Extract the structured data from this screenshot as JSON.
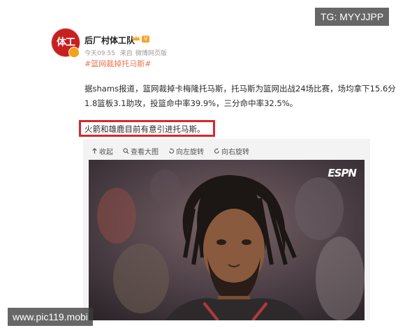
{
  "post": {
    "user_name": "后厂村体工队",
    "level_badge": "V",
    "time": "今天09:55",
    "source_prefix": "来自",
    "source": "微博网页版",
    "topic": "#篮网裁掉托马斯#",
    "body_lines": [
      "据shams报道，篮网裁掉卡梅隆托马斯，托马斯为篮网出战24场比赛，场均拿下15.6分",
      "1.8篮板3.1助攻，投篮命中率39.9%，三分命中率32.5%。"
    ],
    "highlight_text": "火箭和雄鹿目前有意引进托马斯。"
  },
  "media_toolbar": {
    "collapse": "收起",
    "view_large": "查看大图",
    "rotate_left": "向左旋转",
    "rotate_right": "向右旋转"
  },
  "photo": {
    "logo": "ESPN"
  },
  "watermarks": {
    "top": "TG: MYYJJPP",
    "bottom": "www.pic119.mobi"
  }
}
